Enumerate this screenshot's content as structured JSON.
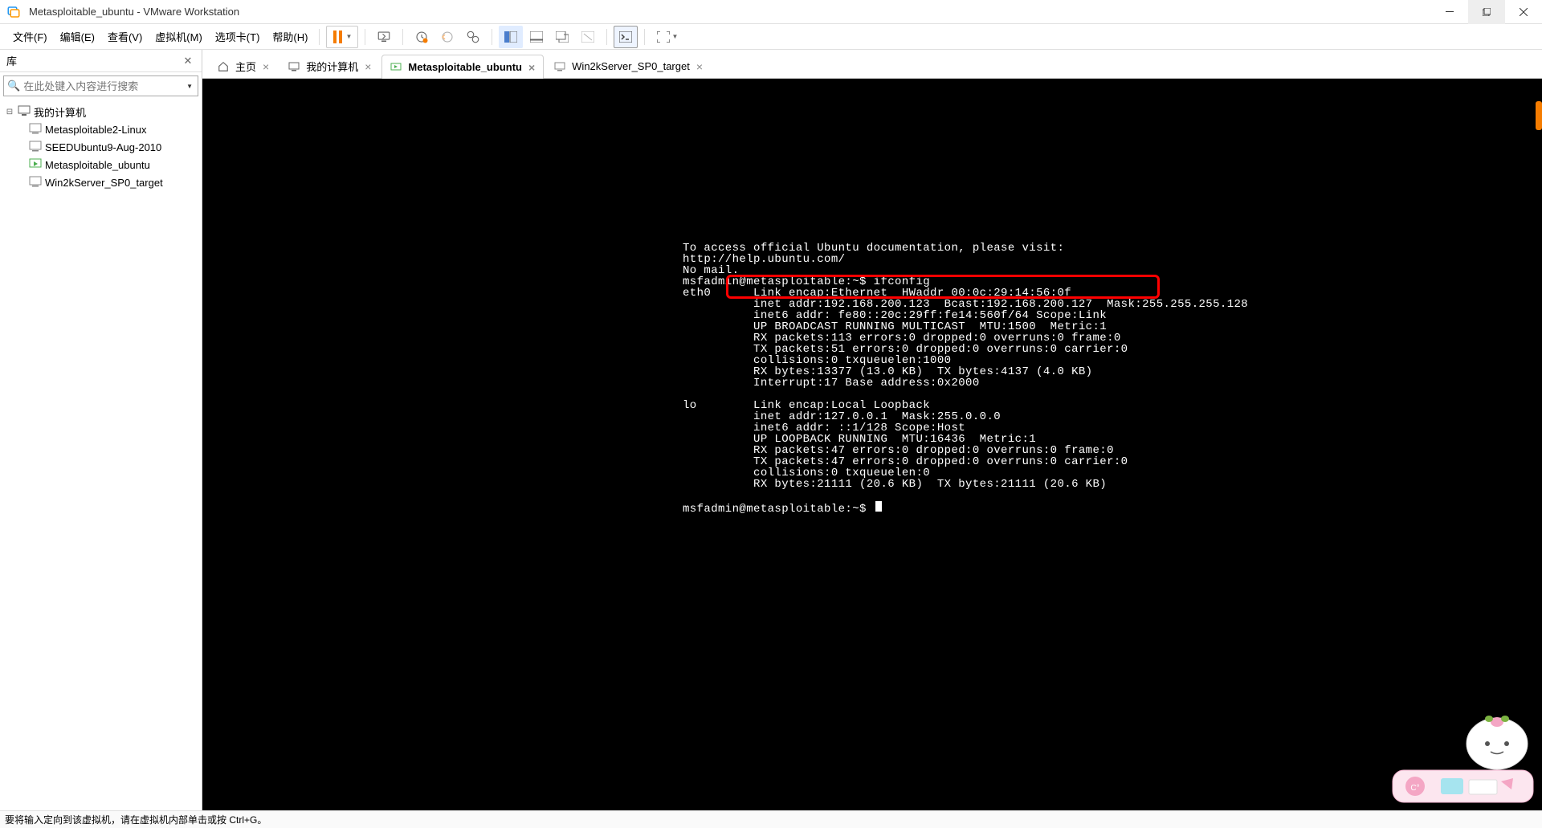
{
  "window": {
    "title": "Metasploitable_ubuntu - VMware Workstation"
  },
  "menu": {
    "file": "文件(F)",
    "edit": "编辑(E)",
    "view": "查看(V)",
    "vm": "虚拟机(M)",
    "tabs": "选项卡(T)",
    "help": "帮助(H)"
  },
  "sidebar": {
    "title": "库",
    "search_placeholder": "在此处键入内容进行搜索",
    "root": "我的计算机",
    "items": [
      "Metasploitable2-Linux",
      "SEEDUbuntu9-Aug-2010",
      "Metasploitable_ubuntu",
      "Win2kServer_SP0_target"
    ]
  },
  "tabs": {
    "home": "主页",
    "mycomputer": "我的计算机",
    "metasploitable": "Metasploitable_ubuntu",
    "win2k": "Win2kServer_SP0_target"
  },
  "terminal": {
    "line1": "To access official Ubuntu documentation, please visit:",
    "line2": "http://help.ubuntu.com/",
    "line3": "No mail.",
    "line4": "msfadmin@metasploitable:~$ ifconfig",
    "line5": "eth0      Link encap:Ethernet  HWaddr 00:0c:29:14:56:0f",
    "line6": "          inet addr:192.168.200.123  Bcast:192.168.200.127  Mask:255.255.255.128",
    "line7": "          inet6 addr: fe80::20c:29ff:fe14:560f/64 Scope:Link",
    "line8": "          UP BROADCAST RUNNING MULTICAST  MTU:1500  Metric:1",
    "line9": "          RX packets:113 errors:0 dropped:0 overruns:0 frame:0",
    "line10": "          TX packets:51 errors:0 dropped:0 overruns:0 carrier:0",
    "line11": "          collisions:0 txqueuelen:1000",
    "line12": "          RX bytes:13377 (13.0 KB)  TX bytes:4137 (4.0 KB)",
    "line13": "          Interrupt:17 Base address:0x2000",
    "line14": "",
    "line15": "lo        Link encap:Local Loopback",
    "line16": "          inet addr:127.0.0.1  Mask:255.0.0.0",
    "line17": "          inet6 addr: ::1/128 Scope:Host",
    "line18": "          UP LOOPBACK RUNNING  MTU:16436  Metric:1",
    "line19": "          RX packets:47 errors:0 dropped:0 overruns:0 frame:0",
    "line20": "          TX packets:47 errors:0 dropped:0 overruns:0 carrier:0",
    "line21": "          collisions:0 txqueuelen:0",
    "line22": "          RX bytes:21111 (20.6 KB)  TX bytes:21111 (20.6 KB)",
    "line23": "",
    "line24": "msfadmin@metasploitable:~$ "
  },
  "statusbar": {
    "hint": "要将输入定向到该虚拟机，请在虚拟机内部单击或按 Ctrl+G。"
  }
}
